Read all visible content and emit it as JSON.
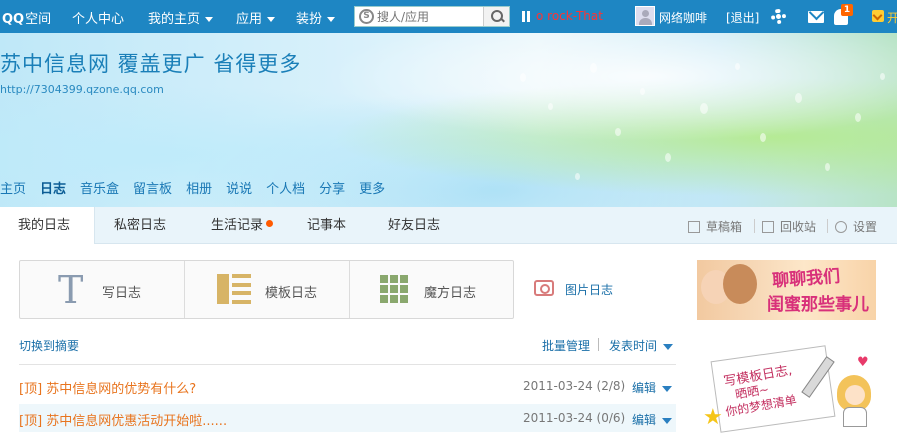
{
  "topbar": {
    "logo_brand": "QQ",
    "logo_suffix": "空间",
    "nav": [
      {
        "label": "个人中心"
      },
      {
        "label": "我的主页"
      },
      {
        "label": "应用"
      },
      {
        "label": "装扮"
      }
    ],
    "search_placeholder": "搜人/应用",
    "now_playing": "o rock-That",
    "username": "网络咖啡",
    "logout": "[退出]",
    "notification_count": "1",
    "vip_label": "开",
    "icons": [
      "search-icon",
      "pause-icon",
      "avatar",
      "gear-icon",
      "mail-icon",
      "bell-icon",
      "vip-icon"
    ]
  },
  "banner": {
    "title": "苏中信息网  覆盖更广  省得更多",
    "url": "http://7304399.qzone.qq.com",
    "nav": [
      {
        "label": "主页"
      },
      {
        "label": "日志"
      },
      {
        "label": "音乐盒"
      },
      {
        "label": "留言板"
      },
      {
        "label": "相册"
      },
      {
        "label": "说说"
      },
      {
        "label": "个人档"
      },
      {
        "label": "分享"
      },
      {
        "label": "更多"
      }
    ],
    "active_nav": "日志"
  },
  "tabs": [
    {
      "label": "我的日志"
    },
    {
      "label": "私密日志"
    },
    {
      "label": "生活记录"
    },
    {
      "label": "记事本"
    },
    {
      "label": "好友日志"
    }
  ],
  "tools": [
    {
      "label": "草稿箱"
    },
    {
      "label": "回收站"
    },
    {
      "label": "设置"
    }
  ],
  "write": {
    "write_label": "写日志",
    "template_label": "模板日志",
    "magic_label": "魔方日志",
    "photo_label": "图片日志"
  },
  "list": {
    "switch_label": "切换到摘要",
    "bulk_label": "批量管理",
    "sort_label": "发表时间",
    "rows": [
      {
        "title": "[顶] 苏中信息网的优势有什么?",
        "date": "2011-03-24 (2/8)",
        "edit": "编辑"
      },
      {
        "title": "[顶] 苏中信息网优惠活动开始啦......",
        "date": "2011-03-24 (0/6)",
        "edit": "编辑"
      }
    ]
  },
  "ads": {
    "ad1_line1": "聊聊我们",
    "ad1_line2": "闺蜜那些事儿",
    "ad2_line1": "写模板日志,",
    "ad2_line2": "晒晒~",
    "ad2_line3": "你的梦想清单"
  },
  "colors": {
    "topbar": "#1e86c3",
    "link": "#1a6fa8",
    "post_title": "#e8741e",
    "new_dot": "#ff5a00"
  }
}
